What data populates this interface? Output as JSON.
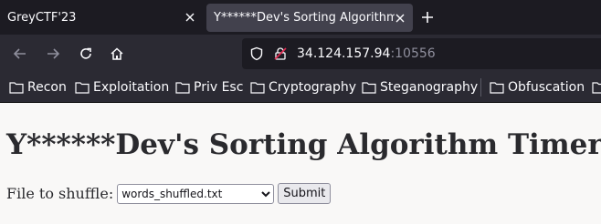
{
  "browser": {
    "tabs": [
      {
        "title": "GreyCTF'23",
        "active": false
      },
      {
        "title": "Y******Dev's Sorting Algorithm Timer",
        "active": true
      }
    ],
    "url": {
      "host": "34.124.157.94",
      "port": ":10556"
    },
    "bookmarks": [
      "Recon",
      "Exploitation",
      "Priv Esc",
      "Cryptography",
      "Steganography",
      "Obfuscation"
    ],
    "icons": {
      "back": "back-arrow-icon",
      "forward": "forward-arrow-icon",
      "reload": "reload-icon",
      "home": "home-icon",
      "shield": "tracking-shield-icon",
      "insecure": "insecure-lock-icon"
    }
  },
  "page": {
    "heading": "Y******Dev's Sorting Algorithm Timer",
    "form": {
      "label": "File to shuffle:",
      "select_value": "words_shuffled.txt",
      "submit_label": "Submit"
    }
  },
  "colors": {
    "chrome_dark": "#1c1b22",
    "toolbar": "#2b2a33",
    "active_tab": "#42414d",
    "page_bg": "#f9f8f7"
  }
}
